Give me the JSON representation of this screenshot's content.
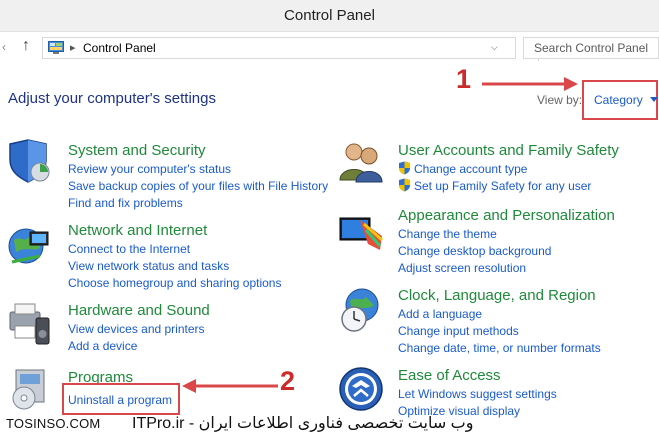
{
  "window": {
    "title": "Control Panel"
  },
  "address": {
    "path": "Control Panel",
    "search_placeholder": "Search Control Panel",
    "icons": {
      "back": "back-arrow-icon",
      "up": "up-arrow-icon",
      "location": "control-panel-icon",
      "refresh": "refresh-icon"
    }
  },
  "header": {
    "heading": "Adjust your computer's settings",
    "view_by_label": "View by:",
    "view_by_value": "Category"
  },
  "annotations": {
    "one": "1",
    "two": "2",
    "accent_color": "#cc2b2b"
  },
  "categories": {
    "system": {
      "title": "System and Security",
      "links": [
        "Review your computer's status",
        "Save backup copies of your files with File History",
        "Find and fix problems"
      ]
    },
    "network": {
      "title": "Network and Internet",
      "links": [
        "Connect to the Internet",
        "View network status and tasks",
        "Choose homegroup and sharing options"
      ]
    },
    "hardware": {
      "title": "Hardware and Sound",
      "links": [
        "View devices and printers",
        "Add a device"
      ]
    },
    "programs": {
      "title": "Programs",
      "links": [
        "Uninstall a program"
      ]
    },
    "accounts": {
      "title": "User Accounts and Family Safety",
      "links": [
        "Change account type",
        "Set up Family Safety for any user"
      ]
    },
    "appearance": {
      "title": "Appearance and Personalization",
      "links": [
        "Change the theme",
        "Change desktop background",
        "Adjust screen resolution"
      ]
    },
    "clock": {
      "title": "Clock, Language, and Region",
      "links": [
        "Add a language",
        "Change input methods",
        "Change date, time, or number formats"
      ]
    },
    "ease": {
      "title": "Ease of Access",
      "links": [
        "Let Windows suggest settings",
        "Optimize visual display"
      ]
    }
  },
  "colors": {
    "title_green": "#1e8a3a",
    "link_blue": "#1a5bcc",
    "heading_blue": "#1e3287"
  },
  "watermark": {
    "left": "TOSINSO.COM",
    "right": "وب سایت تخصصی فناوری اطلاعات ایران - ITPro.ir"
  }
}
